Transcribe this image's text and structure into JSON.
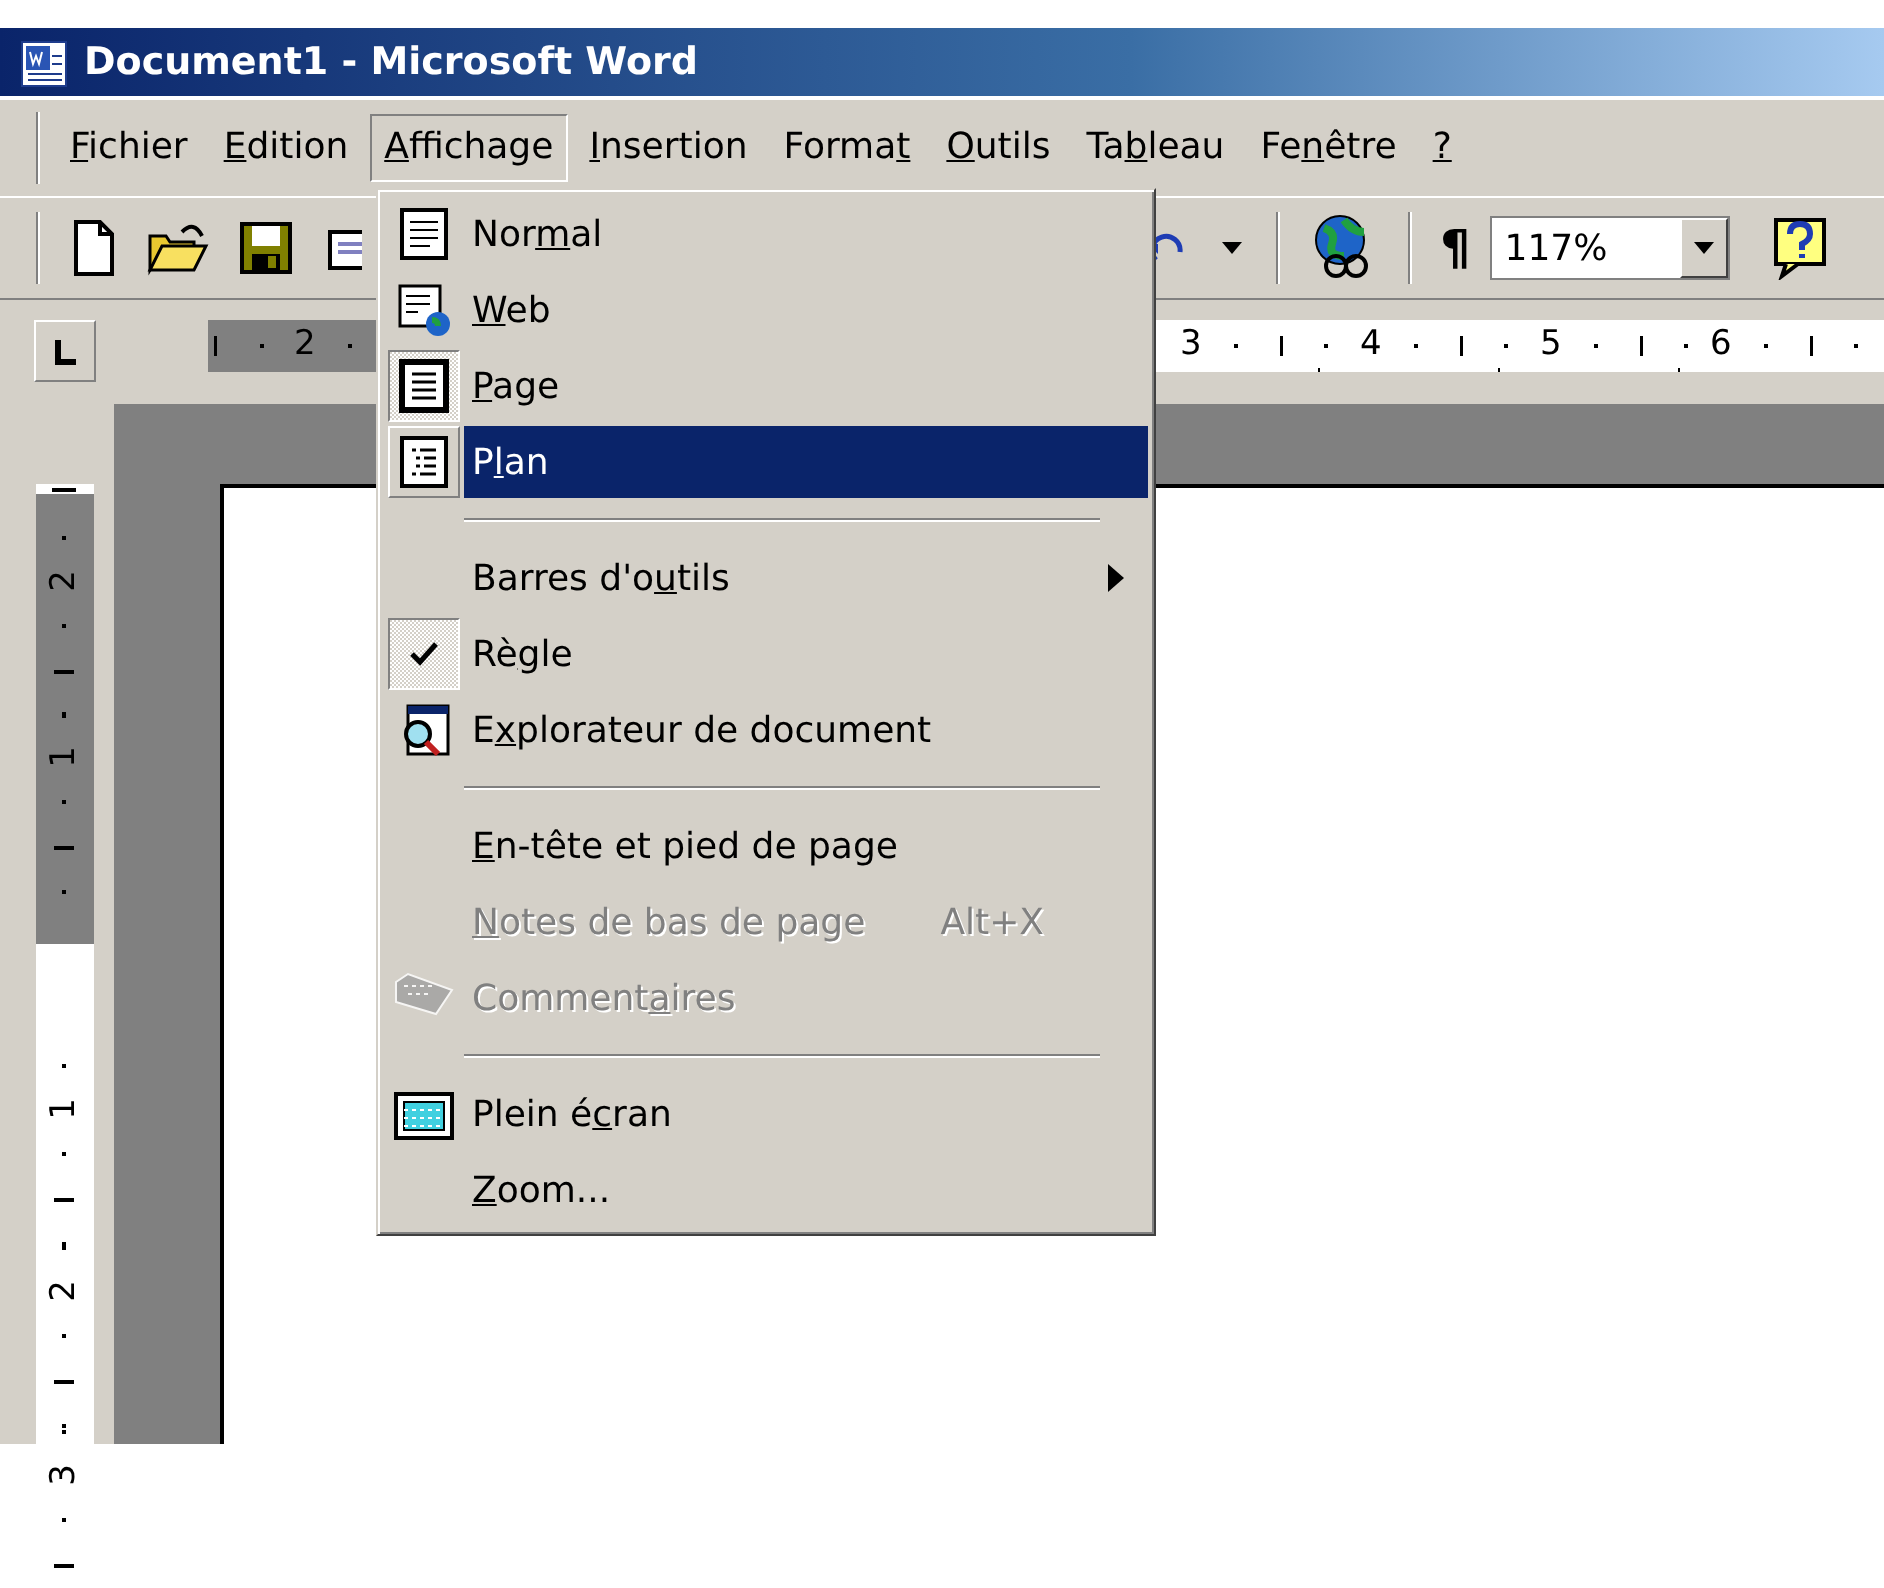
{
  "window": {
    "title": "Document1 - Microsoft Word"
  },
  "menubar": [
    {
      "key": "F",
      "after": "ichier",
      "selected": false
    },
    {
      "key": "E",
      "after": "dition",
      "selected": false
    },
    {
      "key": "A",
      "after": "ffichage",
      "selected": true
    },
    {
      "key": "I",
      "after": "nsertion",
      "selected": false
    },
    {
      "before": "Forma",
      "key": "t",
      "selected": false
    },
    {
      "key": "O",
      "after": "utils",
      "selected": false
    },
    {
      "before": "Ta",
      "key": "b",
      "after": "leau",
      "selected": false
    },
    {
      "before": "Fe",
      "key": "n",
      "after": "être",
      "selected": false
    },
    {
      "key": "?",
      "selected": false
    }
  ],
  "toolbar": {
    "pilcrow": "¶",
    "zoom": "117%"
  },
  "rulers": {
    "horizontal_numbers": [
      "2",
      "3",
      "4",
      "5",
      "6"
    ],
    "vertical_numbers": [
      "2",
      "1",
      "1",
      "2",
      "3"
    ]
  },
  "menu": {
    "items": [
      {
        "kind": "item",
        "before": "Nor",
        "key": "m",
        "after": "al",
        "checked": false,
        "selected": false,
        "disabled": false
      },
      {
        "kind": "item",
        "key": "W",
        "after": "eb",
        "checked": false,
        "selected": false,
        "disabled": false
      },
      {
        "kind": "item",
        "key": "P",
        "after": "age",
        "checked": true,
        "selected": false,
        "disabled": false
      },
      {
        "kind": "item",
        "before": "P",
        "key": "l",
        "after": "an",
        "checked": false,
        "selected": true,
        "disabled": false
      },
      {
        "kind": "separator"
      },
      {
        "kind": "item",
        "before": "Barres d'o",
        "key": "u",
        "after": "tils",
        "submenu": true,
        "checked": false,
        "selected": false,
        "disabled": false
      },
      {
        "kind": "item",
        "before": "Rè",
        "key": "g",
        "after": "le",
        "checked": true,
        "selected": false,
        "disabled": false
      },
      {
        "kind": "item",
        "before": "E",
        "key": "x",
        "after": "plorateur de document",
        "checked": false,
        "selected": false,
        "disabled": false
      },
      {
        "kind": "separator"
      },
      {
        "kind": "item",
        "key": "E",
        "after": "n-tête et pied de page",
        "checked": false,
        "selected": false,
        "disabled": false
      },
      {
        "kind": "item",
        "key": "N",
        "after": "otes de bas de page",
        "shortcut": "Alt+X",
        "checked": false,
        "selected": false,
        "disabled": true
      },
      {
        "kind": "item",
        "before": "Comment",
        "key": "a",
        "after": "ires",
        "checked": false,
        "selected": false,
        "disabled": true
      },
      {
        "kind": "separator"
      },
      {
        "kind": "item",
        "before": "Plein é",
        "key": "c",
        "after": "ran",
        "checked": false,
        "selected": false,
        "disabled": false
      },
      {
        "kind": "item",
        "key": "Z",
        "after": "oom...",
        "checked": false,
        "selected": false,
        "disabled": false
      }
    ]
  }
}
